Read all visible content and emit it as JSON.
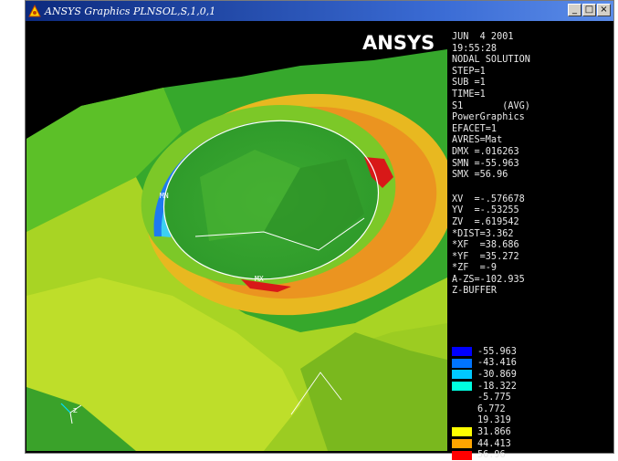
{
  "window": {
    "title": "ANSYS Graphics  PLNSOL,S,1,0,1",
    "controls": {
      "minimize": "_",
      "restore": "□",
      "close": "×"
    }
  },
  "viewport": {
    "logo": "ANSYS",
    "marker_min": "MN",
    "marker_max": "MX"
  },
  "info": {
    "lines_top": [
      "JUN  4 2001",
      "19:55:28",
      "NODAL SOLUTION",
      "STEP=1",
      "SUB =1",
      "TIME=1",
      "S1       (AVG)",
      "PowerGraphics",
      "EFACET=1",
      "AVRES=Mat",
      "DMX =.016263",
      "SMN =-55.963",
      "SMX =56.96"
    ],
    "lines_view": [
      "XV  =-.576678",
      "YV  =-.53255",
      "ZV  =.619542",
      "*DIST=3.362",
      "*XF  =38.686",
      "*YF  =35.272",
      "*ZF  =-9",
      "A-ZS=-102.935",
      "Z-BUFFER"
    ]
  },
  "scale": [
    {
      "value": "-55.963",
      "color": "#0000ff"
    },
    {
      "value": "-43.416",
      "color": "#0074ff"
    },
    {
      "value": "-30.869",
      "color": "#00c8ff"
    },
    {
      "value": "-18.322",
      "color": "#00ffe0"
    },
    {
      "value": "-5.775",
      "color": "#000000"
    },
    {
      "value": "6.772",
      "color": "#000000"
    },
    {
      "value": "19.319",
      "color": "#000000"
    },
    {
      "value": "31.866",
      "color": "#ffff00"
    },
    {
      "value": "44.413",
      "color": "#ffa500"
    },
    {
      "value": "56.96",
      "color": "#ff0000"
    }
  ],
  "colors": {
    "green": "#2ea62e",
    "yellow_green": "#a6d81e",
    "orange": "#e8941e",
    "red": "#d81414",
    "blue": "#1e6ef0"
  }
}
